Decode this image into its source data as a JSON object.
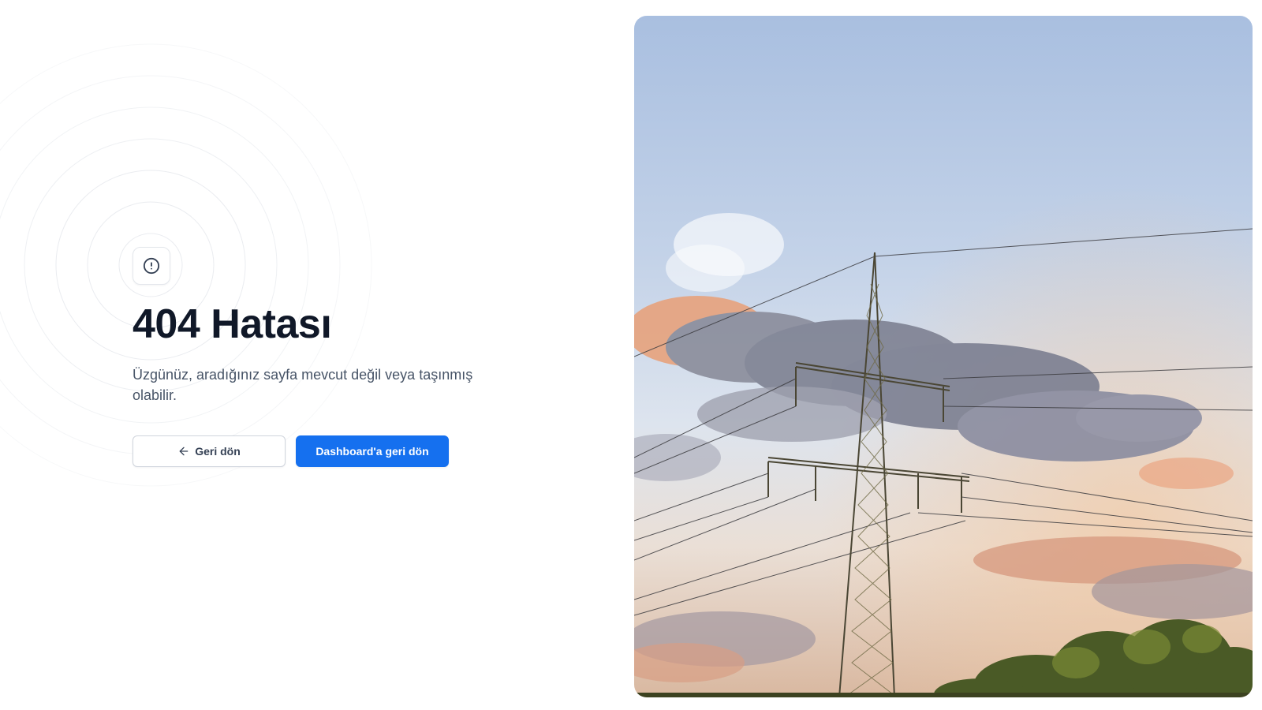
{
  "error": {
    "icon": "alert-circle-icon",
    "title": "404 Hatası",
    "message": "Üzgünüz, aradığınız sayfa mevcut değil veya taşınmış olabilir."
  },
  "actions": {
    "back_label": "Geri dön",
    "back_icon": "arrow-left-icon",
    "dashboard_label": "Dashboard'a geri dön"
  },
  "colors": {
    "primary": "#1570ef",
    "title": "#101828",
    "text": "#475467"
  },
  "illustration": {
    "icon": "power-line-tower-photo"
  }
}
